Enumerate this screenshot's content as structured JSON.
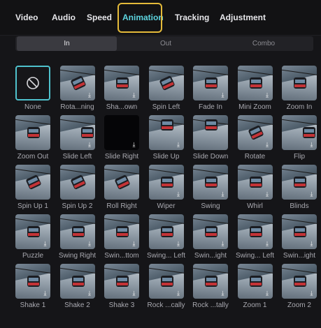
{
  "tabs": [
    {
      "label": "Video",
      "active": false
    },
    {
      "label": "Audio",
      "active": false
    },
    {
      "label": "Speed",
      "active": false
    },
    {
      "label": "Animation",
      "active": true
    },
    {
      "label": "Tracking",
      "active": false
    },
    {
      "label": "Adjustment",
      "active": false
    }
  ],
  "subtabs": [
    {
      "label": "In",
      "active": true
    },
    {
      "label": "Out",
      "active": false
    },
    {
      "label": "Combo",
      "active": false
    }
  ],
  "items": [
    {
      "label": "None",
      "download": false,
      "variant": "none"
    },
    {
      "label": "Rota...ning",
      "download": true,
      "variant": "rotated"
    },
    {
      "label": "Sha...own",
      "download": true,
      "variant": "normal"
    },
    {
      "label": "Spin Left",
      "download": false,
      "variant": "rotated"
    },
    {
      "label": "Fade In",
      "download": true,
      "variant": "normal"
    },
    {
      "label": "Mini Zoom",
      "download": true,
      "variant": "normal"
    },
    {
      "label": "Zoom In",
      "download": false,
      "variant": "normal"
    },
    {
      "label": "Zoom Out",
      "download": false,
      "variant": "normal"
    },
    {
      "label": "Slide Left",
      "download": true,
      "variant": "partial-left"
    },
    {
      "label": "Slide Right",
      "download": true,
      "variant": "dark"
    },
    {
      "label": "Slide Up",
      "download": true,
      "variant": "partial-up"
    },
    {
      "label": "Slide Down",
      "download": false,
      "variant": "partial-up"
    },
    {
      "label": "Rotate",
      "download": true,
      "variant": "rotated"
    },
    {
      "label": "Flip",
      "download": true,
      "variant": "partial-left"
    },
    {
      "label": "Spin Up 1",
      "download": false,
      "variant": "rotated"
    },
    {
      "label": "Spin Up 2",
      "download": false,
      "variant": "rotated"
    },
    {
      "label": "Roll Right",
      "download": false,
      "variant": "rotated"
    },
    {
      "label": "Wiper",
      "download": true,
      "variant": "normal"
    },
    {
      "label": "Swing",
      "download": true,
      "variant": "normal"
    },
    {
      "label": "Whirl",
      "download": true,
      "variant": "normal"
    },
    {
      "label": "Blinds",
      "download": true,
      "variant": "normal"
    },
    {
      "label": "Puzzle",
      "download": true,
      "variant": "normal"
    },
    {
      "label": "Swing Right",
      "download": true,
      "variant": "normal"
    },
    {
      "label": "Swin...ttom",
      "download": true,
      "variant": "normal"
    },
    {
      "label": "Swing... Left",
      "download": true,
      "variant": "normal"
    },
    {
      "label": "Swin...ight",
      "download": true,
      "variant": "normal"
    },
    {
      "label": "Swing... Left",
      "download": true,
      "variant": "normal"
    },
    {
      "label": "Swin...ight",
      "download": true,
      "variant": "normal"
    },
    {
      "label": "Shake 1",
      "download": true,
      "variant": "normal"
    },
    {
      "label": "Shake 2",
      "download": true,
      "variant": "normal"
    },
    {
      "label": "Shake 3",
      "download": true,
      "variant": "normal"
    },
    {
      "label": "Rock ...cally",
      "download": true,
      "variant": "normal"
    },
    {
      "label": "Rock ...tally",
      "download": true,
      "variant": "normal"
    },
    {
      "label": "Zoom 1",
      "download": true,
      "variant": "normal"
    },
    {
      "label": "Zoom 2",
      "download": true,
      "variant": "normal"
    }
  ],
  "icons": {
    "none": "prohibited-icon",
    "download": "download-icon"
  },
  "colors": {
    "accent": "#5dd4df",
    "highlight": "#e4ba3a",
    "background": "#151518"
  }
}
